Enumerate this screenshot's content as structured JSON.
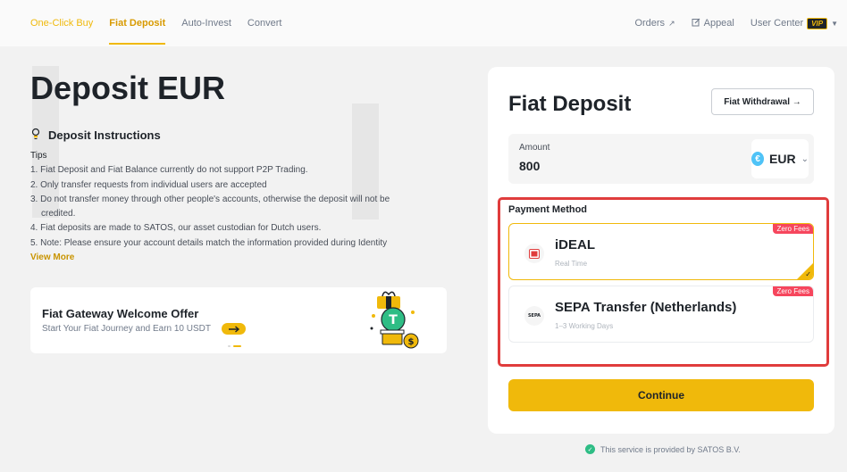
{
  "nav": {
    "tabs": [
      {
        "label": "One-Click Buy"
      },
      {
        "label": "Fiat Deposit"
      },
      {
        "label": "Auto-Invest"
      },
      {
        "label": "Convert"
      }
    ],
    "orders": "Orders",
    "appeal": "Appeal",
    "user_center": "User Center",
    "vip_badge": "VIP"
  },
  "page": {
    "title": "Deposit EUR",
    "instructions_heading": "Deposit Instructions",
    "tips_label": "Tips",
    "tips": [
      "1. Fiat Deposit and Fiat Balance currently do not support P2P Trading.",
      "2. Only transfer requests from individual users are accepted",
      "3. Do not transfer money through other people's accounts, otherwise the deposit will not be",
      "credited.",
      "4. Fiat deposits are made to SATOS, our asset custodian for Dutch users.",
      "5. Note: Please ensure your account details match the information provided during Identity"
    ],
    "view_more": "View More"
  },
  "offer": {
    "title": "Fiat Gateway Welcome Offer",
    "subtitle": "Start Your Fiat Journey and Earn 10 USDT",
    "arrow": "→"
  },
  "card": {
    "title": "Fiat Deposit",
    "withdraw_button": "Fiat Withdrawal →",
    "amount_label": "Amount",
    "amount_value": "800",
    "currency": "EUR",
    "currency_symbol": "€",
    "payment_method_label": "Payment Method",
    "methods": [
      {
        "name": "iDEAL",
        "time": "Real Time",
        "badge": "Zero Fees",
        "selected": true
      },
      {
        "name": "SEPA Transfer (Netherlands)",
        "time": "1–3 Working Days",
        "badge": "Zero Fees",
        "logo_text": "SEPA",
        "selected": false
      }
    ],
    "continue_button": "Continue"
  },
  "footer": {
    "provided_by": "This service is provided by SATOS B.V."
  },
  "colors": {
    "accent": "#f0b90b",
    "badge_red": "#f6465d",
    "highlight_border": "#e03c3c",
    "success": "#2ebd85"
  }
}
